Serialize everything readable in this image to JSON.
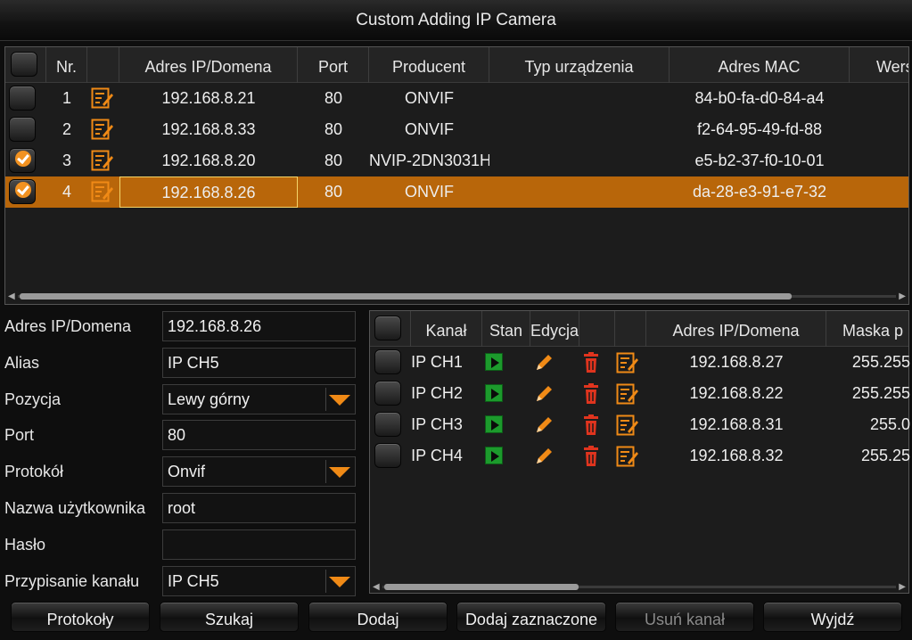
{
  "window": {
    "title": "Custom Adding IP Camera"
  },
  "device_table": {
    "columns": [
      "Nr.",
      "",
      "Adres IP/Domena",
      "Port",
      "Producent",
      "Typ urządzenia",
      "Adres MAC",
      "Wers"
    ],
    "rows": [
      {
        "nr": "1",
        "ip": "192.168.8.21",
        "port": "80",
        "producer": "ONVIF",
        "type": "",
        "mac": "84-b0-fa-d0-84-a4",
        "checked": false,
        "selected": false
      },
      {
        "nr": "2",
        "ip": "192.168.8.33",
        "port": "80",
        "producer": "ONVIF",
        "type": "",
        "mac": "f2-64-95-49-fd-88",
        "checked": false,
        "selected": false
      },
      {
        "nr": "3",
        "ip": "192.168.8.20",
        "port": "80",
        "producer": "NVIP-2DN3031H",
        "type": "",
        "mac": "e5-b2-37-f0-10-01",
        "checked": true,
        "selected": false
      },
      {
        "nr": "4",
        "ip": "192.168.8.26",
        "port": "80",
        "producer": "ONVIF",
        "type": "",
        "mac": "da-28-e3-91-e7-32",
        "checked": true,
        "selected": true
      }
    ]
  },
  "form": {
    "ip_label": "Adres IP/Domena",
    "ip_value": "192.168.8.26",
    "alias_label": "Alias",
    "alias_value": "IP CH5",
    "position_label": "Pozycja",
    "position_value": "Lewy górny",
    "port_label": "Port",
    "port_value": "80",
    "protocol_label": "Protokół",
    "protocol_value": "Onvif",
    "user_label": "Nazwa użytkownika",
    "user_value": "root",
    "password_label": "Hasło",
    "password_value": "",
    "channel_label": "Przypisanie kanału",
    "channel_value": "IP CH5"
  },
  "channel_table": {
    "columns": [
      "Kanał",
      "Stan",
      "Edycja",
      "",
      "",
      "Adres IP/Domena",
      "Maska p"
    ],
    "rows": [
      {
        "channel": "IP CH1",
        "ip": "192.168.8.27",
        "mask": "255.255"
      },
      {
        "channel": "IP CH2",
        "ip": "192.168.8.22",
        "mask": "255.255"
      },
      {
        "channel": "IP CH3",
        "ip": "192.168.8.31",
        "mask": "255.0"
      },
      {
        "channel": "IP CH4",
        "ip": "192.168.8.32",
        "mask": "255.25"
      }
    ]
  },
  "buttons": {
    "protocols": "Protokoły",
    "search": "Szukaj",
    "add": "Dodaj",
    "add_selected": "Dodaj zaznaczone",
    "remove_channel": "Usuń kanał",
    "exit": "Wyjdź"
  },
  "colors": {
    "accent": "#f08a16",
    "selected_row": "#b8660a",
    "play": "#1c9a2c",
    "delete": "#e0341e"
  }
}
